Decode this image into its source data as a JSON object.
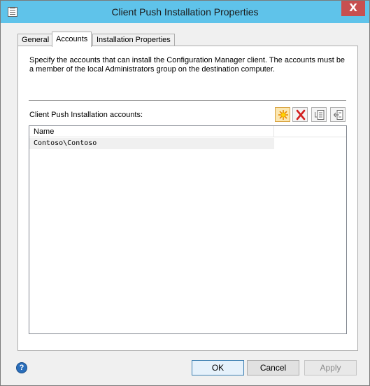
{
  "window": {
    "title": "Client Push Installation Properties",
    "close_glyph": "X"
  },
  "tabs": [
    {
      "label": "General"
    },
    {
      "label": "Accounts"
    },
    {
      "label": "Installation Properties"
    }
  ],
  "accounts": {
    "description": "Specify the accounts that can install the Configuration Manager client. The accounts must be a member of the local Administrators group on the destination computer.",
    "list_label": "Client Push Installation accounts:",
    "toolbar": {
      "new_icon": "starburst-new-icon",
      "delete_icon": "red-x-delete-icon",
      "edit_icon": "edit-properties-icon",
      "verify_icon": "verify-account-icon"
    },
    "columns": [
      "Name"
    ],
    "rows": [
      {
        "name": "Contoso\\Contoso"
      }
    ]
  },
  "footer": {
    "help_glyph": "?",
    "ok_label": "OK",
    "cancel_label": "Cancel",
    "apply_label": "Apply"
  },
  "colors": {
    "title_bar": "#5fc3ea",
    "close_button": "#c75050",
    "accent_border": "#3c7fb1"
  }
}
